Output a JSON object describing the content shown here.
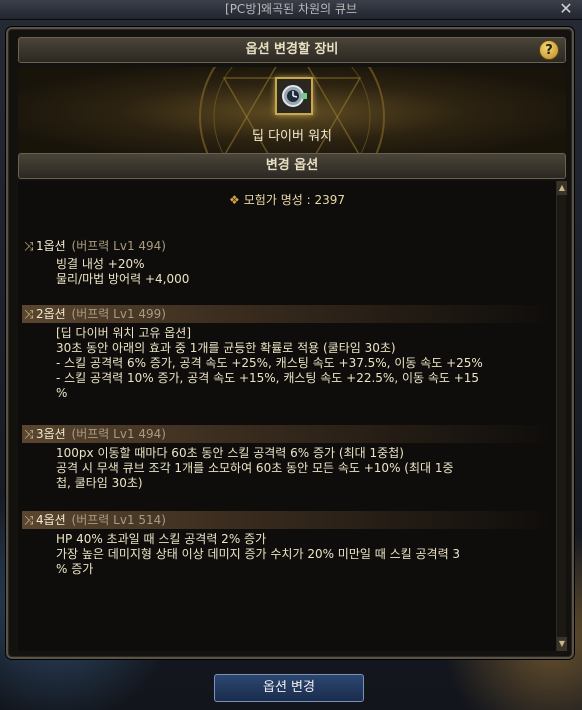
{
  "window": {
    "title": "[PC방]왜곡된 차원의 큐브",
    "close_glyph": "✕"
  },
  "header": {
    "title": "옵션 변경할 장비",
    "help_label": "?"
  },
  "equipment": {
    "name": "딥 다이버 워치"
  },
  "options_section": {
    "title": "변경 옵션"
  },
  "reputation": {
    "text": "모험가 명성 : 2397"
  },
  "options": [
    {
      "number": "1옵션",
      "sub": "(버프력 Lv1 494)",
      "lines": [
        "빙결 내성 +20%",
        "물리/마법 방어력 +4,000"
      ]
    },
    {
      "number": "2옵션",
      "sub": "(버프력 Lv1 499)",
      "lines": [
        "[딥 다이버 워치 고유 옵션]",
        "30초 동안 아래의 효과 중 1개를 균등한 확률로 적용 (쿨타임 30초)",
        "- 스킬 공격력 6% 증가, 공격 속도 +25%, 캐스팅 속도 +37.5%, 이동 속도 +25%",
        "- 스킬 공격력 10% 증가, 공격 속도 +15%, 캐스팅 속도 +22.5%, 이동 속도 +15",
        "%"
      ]
    },
    {
      "number": "3옵션",
      "sub": "(버프력 Lv1 494)",
      "lines": [
        "100px 이동할 때마다 60초 동안 스킬 공격력 6% 증가 (최대 1중첩)",
        "공격 시 무색 큐브 조각 1개를 소모하여 60초 동안 모든 속도 +10% (최대 1중",
        "첩, 쿨타임 30초)"
      ]
    },
    {
      "number": "4옵션",
      "sub": "(버프력 Lv1 514)",
      "lines": [
        "HP 40% 초과일 때 스킬 공격력 2% 증가",
        "가장 높은 데미지형 상태 이상 데미지 증가 수치가 20% 미만일 때 스킬 공격력 3",
        "% 증가"
      ]
    }
  ],
  "footer": {
    "change_button": "옵션 변경"
  },
  "icons": {
    "shuffle": "shuffle-icon",
    "reputation": "reputation-emblem-icon",
    "item": "watch-icon"
  },
  "colors": {
    "gold": "#c9a84a",
    "panel": "#14120f",
    "band": "#5a4630",
    "button": "#2c4770"
  }
}
